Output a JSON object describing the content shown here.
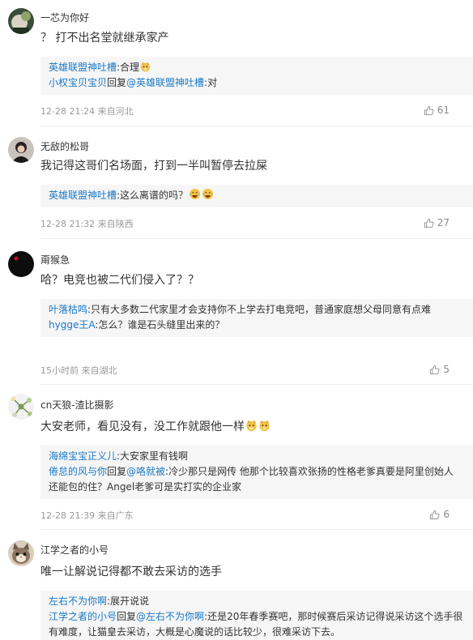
{
  "comments": [
    {
      "username": "一芯为你好",
      "text": "？ 打不出名堂就继承家产",
      "replies": [
        {
          "author": "英雄联盟神吐槽",
          "text": ":合理"
        },
        {
          "author": "小权宝贝宝贝",
          "mid": "回复",
          "target": "@英雄联盟神吐槽",
          "text": ":对"
        }
      ],
      "meta": "12-28 21:24 来自河北",
      "likes": "61"
    },
    {
      "username": "无敌的松哥",
      "text": "我记得这哥们名场面，打到一半叫暂停去拉屎",
      "replies": [
        {
          "author": "英雄联盟神吐槽",
          "text": ":这么离谱的吗？"
        }
      ],
      "meta": "12-28 21:32 来自陕西",
      "likes": "27"
    },
    {
      "username": "甭猴急",
      "text": "哈？电竞也被二代们侵入了？？",
      "replies": [
        {
          "author": "叶落枯鸣",
          "text": ":只有大多数二代家里才会支持你不上学去打电竞吧，普通家庭想父母同意有点难"
        },
        {
          "author": "hygge王A",
          "text": ":怎么？谁是石头缝里出来的？"
        }
      ],
      "meta": "15小时前 来自湖北",
      "likes": "5"
    },
    {
      "username": "cn天狼-渣比摄影",
      "text": "大安老师，看见没有，没工作就跟他一样",
      "replies": [
        {
          "author": "海绵宝宝正义儿",
          "text": ":大安家里有钱啊"
        },
        {
          "author": "倦怠的风与你",
          "mid": "回复",
          "target": "@咯就被",
          "text": ":冷少那只是网传 他那个比较喜欢张扬的性格老爹真要是阿里创始人 还能包的住？Angel老爹可是实打实的企业家"
        }
      ],
      "meta": "12-28 21:39 来自广东",
      "likes": "6"
    },
    {
      "username": "江学之者的小号",
      "text": "唯一让解说记得都不敢去采访的选手",
      "replies": [
        {
          "author": "左右不为你啊",
          "text": ":展开说说"
        },
        {
          "author": "江学之者的小号",
          "mid": "回复",
          "target": "@左右不为你啊",
          "text": ":还是20年春季赛吧，那时候赛后采访记得说采访这个选手很有难度，让猫皇去采访，大概是心魔说的话比较少，很难采访下去。"
        }
      ]
    }
  ],
  "colors": {
    "link": "#1979c7",
    "meta": "#999999",
    "reply_bg": "#f6f6f6",
    "text": "#333333"
  }
}
